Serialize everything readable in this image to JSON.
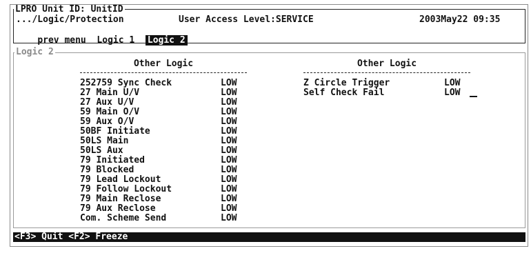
{
  "header": {
    "unit_title": "LPRO Unit ID: UnitID",
    "breadcrumb": ".../Logic/Protection",
    "access_level": "User Access Level:SERVICE",
    "datetime": "2003May22 09:35",
    "menu": {
      "prev": "prev menu",
      "logic1": "Logic 1",
      "logic2": "Logic 2"
    }
  },
  "panel": {
    "title": "Logic 2",
    "left": {
      "header": "Other Logic",
      "items": [
        {
          "name": "252759 Sync Check",
          "value": "LOW"
        },
        {
          "name": "27 Main U/V",
          "value": "LOW"
        },
        {
          "name": "27 Aux U/V",
          "value": "LOW"
        },
        {
          "name": "59 Main O/V",
          "value": "LOW"
        },
        {
          "name": "59 Aux O/V",
          "value": "LOW"
        },
        {
          "name": "50BF Initiate",
          "value": "LOW"
        },
        {
          "name": "50LS Main",
          "value": "LOW"
        },
        {
          "name": "50LS Aux",
          "value": "LOW"
        },
        {
          "name": "79 Initiated",
          "value": "LOW"
        },
        {
          "name": "79 Blocked",
          "value": "LOW"
        },
        {
          "name": "79 Lead Lockout",
          "value": "LOW"
        },
        {
          "name": "79 Follow Lockout",
          "value": "LOW"
        },
        {
          "name": "79 Main Reclose",
          "value": "LOW"
        },
        {
          "name": "79 Aux Reclose",
          "value": "LOW"
        },
        {
          "name": "Com. Scheme Send",
          "value": "LOW"
        }
      ]
    },
    "right": {
      "header": "Other Logic",
      "items": [
        {
          "name": "Z Circle Trigger",
          "value": "LOW"
        },
        {
          "name": "Self Check Fail",
          "value": "LOW"
        }
      ]
    }
  },
  "function_bar": "<F3> Quit <F2> Freeze"
}
